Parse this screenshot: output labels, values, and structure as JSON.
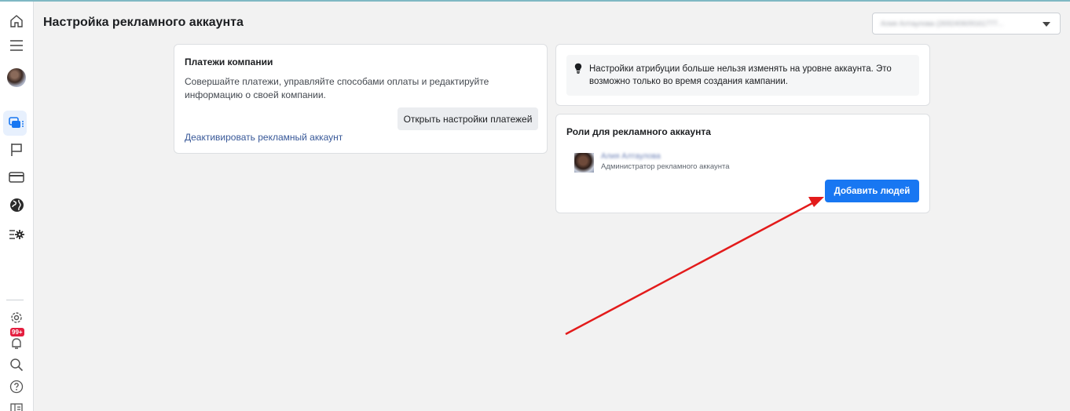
{
  "header": {
    "title": "Настройка рекламного аккаунта",
    "account_selector_value": "Алия Алтаулова (269240609161777..."
  },
  "sidebar": {
    "notifications_badge": "99+"
  },
  "payments_card": {
    "heading": "Платежи компании",
    "description": "Совершайте платежи, управляйте способами оплаты и редактируйте информацию о своей компании.",
    "open_settings_button": "Открыть настройки платежей",
    "deactivate_link": "Деактивировать рекламный аккаунт"
  },
  "attribution_card": {
    "notice": "Настройки атрибуции больше нельзя изменять на уровне аккаунта. Это возможно только во время создания кампании."
  },
  "roles_card": {
    "heading": "Роли для рекламного аккаунта",
    "user_name": "Алия Алтаулова",
    "user_role": "Администратор рекламного аккаунта",
    "add_people_button": "Добавить людей"
  },
  "colors": {
    "primary_button": "#1877f2",
    "annotation_arrow": "#e31b1b",
    "badge": "#e41e3f"
  }
}
